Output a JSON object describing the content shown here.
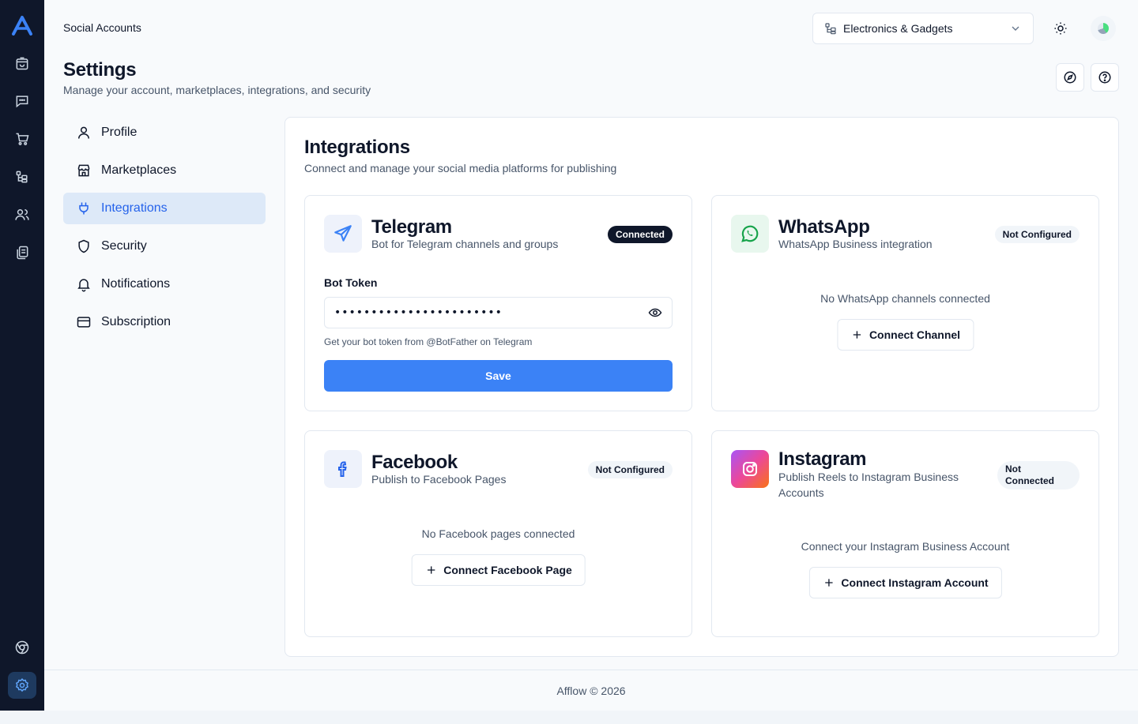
{
  "header": {
    "section_title": "Social Accounts",
    "store_selector": {
      "value": "Electronics & Gadgets",
      "icon": "store-tree-icon"
    }
  },
  "page": {
    "title": "Settings",
    "subtitle": "Manage your account, marketplaces, integrations, and security"
  },
  "rail": {
    "items": [
      "logo-icon",
      "orders-icon",
      "messages-icon",
      "cart-icon",
      "catalog-icon",
      "users-icon",
      "documents-icon",
      "chrome-icon",
      "settings-icon"
    ],
    "active": "settings-icon"
  },
  "settings_nav": {
    "items": [
      {
        "label": "Profile",
        "icon": "user-icon"
      },
      {
        "label": "Marketplaces",
        "icon": "store-icon"
      },
      {
        "label": "Integrations",
        "icon": "plug-icon",
        "active": true
      },
      {
        "label": "Security",
        "icon": "shield-icon"
      },
      {
        "label": "Notifications",
        "icon": "bell-icon"
      },
      {
        "label": "Subscription",
        "icon": "credit-card-icon"
      }
    ]
  },
  "integrations": {
    "title": "Integrations",
    "subtitle": "Connect and manage your social media platforms for publishing",
    "telegram": {
      "name": "Telegram",
      "description": "Bot for Telegram channels and groups",
      "status": "Connected",
      "field_label": "Bot Token",
      "token_value": "•••••••••••••••••••••••",
      "hint": "Get your bot token from @BotFather on Telegram",
      "save_label": "Save"
    },
    "whatsapp": {
      "name": "WhatsApp",
      "description": "WhatsApp Business integration",
      "status": "Not Configured",
      "empty": "No WhatsApp channels connected",
      "button": "Connect Channel"
    },
    "facebook": {
      "name": "Facebook",
      "description": "Publish to Facebook Pages",
      "status": "Not Configured",
      "empty": "No Facebook pages connected",
      "button": "Connect Facebook Page"
    },
    "instagram": {
      "name": "Instagram",
      "description": "Publish Reels to Instagram Business Accounts",
      "status": "Not Connected",
      "empty": "Connect your Instagram Business Account",
      "button": "Connect Instagram Account"
    }
  },
  "colors": {
    "sidebar_bg": "#0f172a",
    "accent": "#3b82f6",
    "active_nav_bg": "#dde9f8",
    "telegram_icon_bg": "#eef2fb",
    "whatsapp_icon_bg": "#e8f7ee",
    "whatsapp_green": "#16a34a"
  },
  "footer": {
    "text": "Afflow © 2026"
  }
}
